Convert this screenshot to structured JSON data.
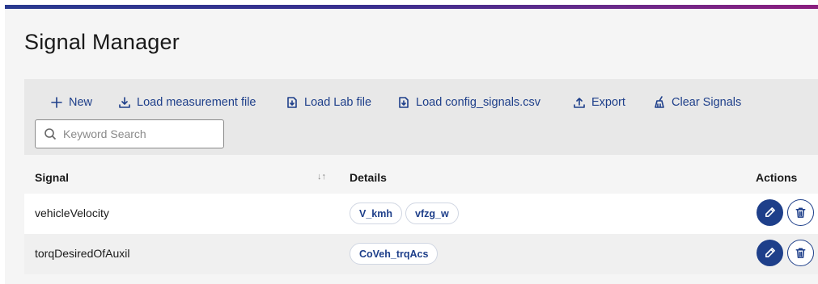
{
  "page": {
    "title": "Signal Manager"
  },
  "toolbar": {
    "new_label": "New",
    "load_measurement_label": "Load measurement file",
    "load_lab_label": "Load Lab file",
    "load_config_label": "Load config_signals.csv",
    "export_label": "Export",
    "clear_label": "Clear Signals"
  },
  "search": {
    "placeholder": "Keyword Search",
    "value": ""
  },
  "table": {
    "headers": {
      "signal": "Signal",
      "details": "Details",
      "actions": "Actions"
    },
    "rows": [
      {
        "signal": "vehicleVelocity",
        "details": [
          "V_kmh",
          "vfzg_w"
        ]
      },
      {
        "signal": "torqDesiredOfAuxil",
        "details": [
          "CoVeh_trqAcs"
        ]
      }
    ]
  },
  "icons": {
    "new": "plus-icon",
    "load_measurement": "download-icon",
    "load_lab": "file-download-icon",
    "load_config": "file-download-icon",
    "export": "upload-icon",
    "clear": "broom-icon",
    "search": "search-icon",
    "sort": "sort-icon",
    "edit": "pencil-icon",
    "delete": "trash-icon"
  },
  "colors": {
    "accent": "#1e3f8a",
    "toolbar_bg": "#e8e8e8",
    "page_bg": "#f5f5f5"
  }
}
